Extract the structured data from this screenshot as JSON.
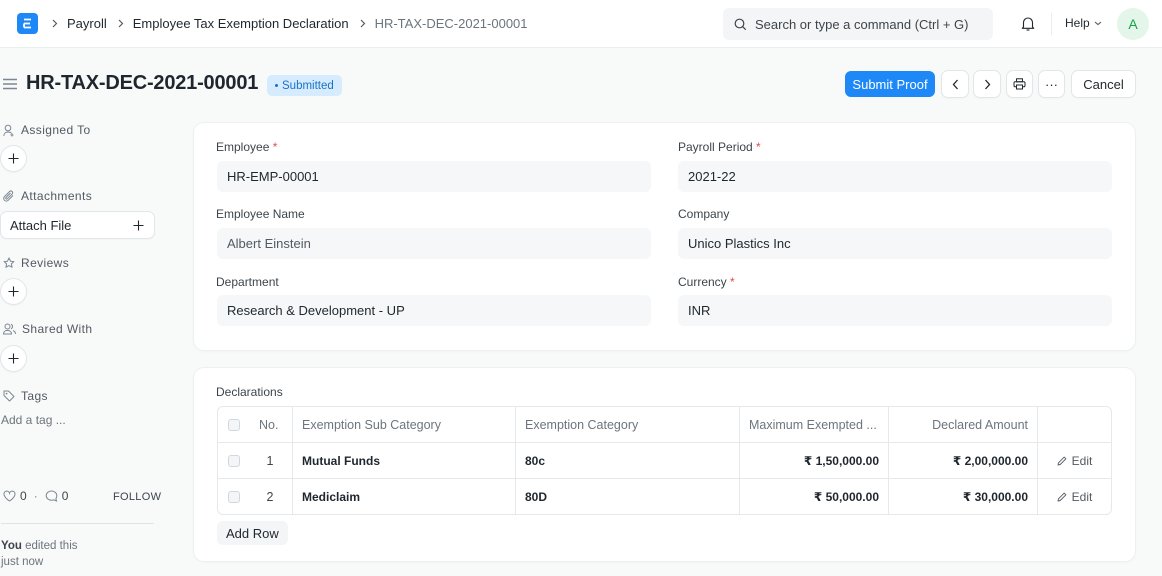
{
  "navbar": {
    "logo_letter": "E",
    "breadcrumbs": [
      "Payroll",
      "Employee Tax Exemption Declaration",
      "HR-TAX-DEC-2021-00001"
    ],
    "search_placeholder": "Search or type a command (Ctrl + G)",
    "help_label": "Help",
    "avatar_initial": "A"
  },
  "header": {
    "title": "HR-TAX-DEC-2021-00001",
    "status": "Submitted",
    "submit_label": "Submit Proof",
    "cancel_label": "Cancel",
    "more_label": "···"
  },
  "sidebar": {
    "assigned_to": "Assigned To",
    "attachments": "Attachments",
    "attach_file": "Attach File",
    "reviews": "Reviews",
    "shared_with": "Shared With",
    "tags": "Tags",
    "add_tag": "Add a tag ...",
    "likes": "0",
    "comments": "0",
    "follow": "FOLLOW",
    "activity_user": "You",
    "activity_text": " edited this",
    "activity_time": "just now"
  },
  "form": {
    "employee_label": "Employee",
    "employee_value": "HR-EMP-00001",
    "employee_name_label": "Employee Name",
    "employee_name_value": "Albert Einstein",
    "department_label": "Department",
    "department_value": "Research & Development - UP",
    "payroll_period_label": "Payroll Period",
    "payroll_period_value": "2021-22",
    "company_label": "Company",
    "company_value": "Unico Plastics Inc",
    "currency_label": "Currency",
    "currency_value": "INR",
    "required_mark": "*"
  },
  "declarations": {
    "label": "Declarations",
    "columns": [
      "No.",
      "Exemption Sub Category",
      "Exemption Category",
      "Maximum Exempted ...",
      "Declared Amount"
    ],
    "rows": [
      {
        "no": "1",
        "sub_category": "Mutual Funds",
        "category": "80c",
        "max_exempted": "₹ 1,50,000.00",
        "declared": "₹ 2,00,000.00",
        "edit": "Edit"
      },
      {
        "no": "2",
        "sub_category": "Mediclaim",
        "category": "80D",
        "max_exempted": "₹ 50,000.00",
        "declared": "₹ 30,000.00",
        "edit": "Edit"
      }
    ],
    "add_row": "Add Row"
  }
}
